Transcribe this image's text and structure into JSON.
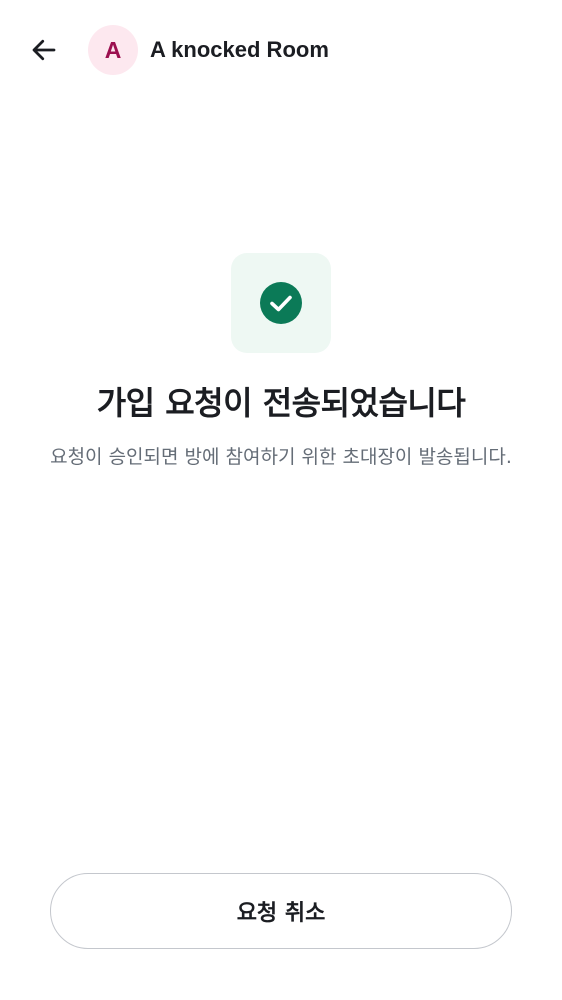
{
  "header": {
    "avatar_letter": "A",
    "room_name": "A knocked Room",
    "back_icon": "arrow-left-icon"
  },
  "main": {
    "status_icon": "check-circle-icon",
    "title": "가입 요청이 전송되었습니다",
    "description": "요청이 승인되면 방에 참여하기 위한 초대장이 발송됩니다."
  },
  "footer": {
    "cancel_label": "요청 취소"
  },
  "colors": {
    "avatar_bg": "#fde8ef",
    "avatar_text": "#9c0f4f",
    "icon_box_bg": "#eef8f3",
    "check_green": "#0b7a57",
    "text_primary": "#1b1d22",
    "text_secondary": "#656d77",
    "button_border": "#c4c7cd"
  }
}
